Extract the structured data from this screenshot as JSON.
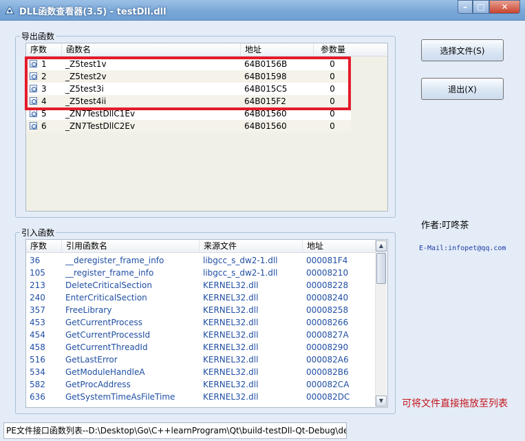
{
  "window": {
    "title": "DLL函数查看器(3.5) - testDll.dll",
    "minimize_symbol": "–",
    "maximize_symbol": "□",
    "close_symbol": "✕"
  },
  "export_group": {
    "label": "导出函数",
    "columns": [
      "序数",
      "函数名",
      "地址",
      "参数量"
    ],
    "rows": [
      {
        "ordinal": "1",
        "name": "_Z5test1v",
        "address": "64B0156B",
        "params": "0"
      },
      {
        "ordinal": "2",
        "name": "_Z5test2v",
        "address": "64B01598",
        "params": "0"
      },
      {
        "ordinal": "3",
        "name": "_Z5test3i",
        "address": "64B015C5",
        "params": "0"
      },
      {
        "ordinal": "4",
        "name": "_Z5test4ii",
        "address": "64B015F2",
        "params": "0"
      },
      {
        "ordinal": "5",
        "name": "_ZN7TestDllC1Ev",
        "address": "64B01560",
        "params": "0"
      },
      {
        "ordinal": "6",
        "name": "_ZN7TestDllC2Ev",
        "address": "64B01560",
        "params": "0"
      }
    ]
  },
  "import_group": {
    "label": "引入函数",
    "columns": [
      "序数",
      "引用函数名",
      "来源文件",
      "地址"
    ],
    "rows": [
      {
        "ordinal": "36",
        "name": "__deregister_frame_info",
        "source": "libgcc_s_dw2-1.dll",
        "address": "000081F4"
      },
      {
        "ordinal": "105",
        "name": "__register_frame_info",
        "source": "libgcc_s_dw2-1.dll",
        "address": "00008210"
      },
      {
        "ordinal": "213",
        "name": "DeleteCriticalSection",
        "source": "KERNEL32.dll",
        "address": "00008228"
      },
      {
        "ordinal": "240",
        "name": "EnterCriticalSection",
        "source": "KERNEL32.dll",
        "address": "00008240"
      },
      {
        "ordinal": "357",
        "name": "FreeLibrary",
        "source": "KERNEL32.dll",
        "address": "00008258"
      },
      {
        "ordinal": "453",
        "name": "GetCurrentProcess",
        "source": "KERNEL32.dll",
        "address": "00008266"
      },
      {
        "ordinal": "454",
        "name": "GetCurrentProcessId",
        "source": "KERNEL32.dll",
        "address": "0000827A"
      },
      {
        "ordinal": "458",
        "name": "GetCurrentThreadId",
        "source": "KERNEL32.dll",
        "address": "00008290"
      },
      {
        "ordinal": "516",
        "name": "GetLastError",
        "source": "KERNEL32.dll",
        "address": "000082A6"
      },
      {
        "ordinal": "534",
        "name": "GetModuleHandleA",
        "source": "KERNEL32.dll",
        "address": "000082B6"
      },
      {
        "ordinal": "582",
        "name": "GetProcAddress",
        "source": "KERNEL32.dll",
        "address": "000082CA"
      },
      {
        "ordinal": "636",
        "name": "GetSystemTimeAsFileTime",
        "source": "KERNEL32.dll",
        "address": "000082DC"
      }
    ]
  },
  "buttons": {
    "select_file": "选择文件(S)",
    "exit": "退出(X)"
  },
  "author": "作者:叮咚茶",
  "email": "E-Mail:infopet@qq.com",
  "drag_hint": "可将文件直接拖放至列表",
  "status": "PE文件接口函数列表--D:\\Desktop\\Go\\C++learnProgram\\Qt\\build-testDll-Qt-Debug\\de",
  "scrollbar": {
    "up": "▲",
    "down": "▼"
  },
  "colors": {
    "highlight": "#e41b2a",
    "import_text": "#1f4ea3",
    "drag_hint": "#c3141c"
  }
}
